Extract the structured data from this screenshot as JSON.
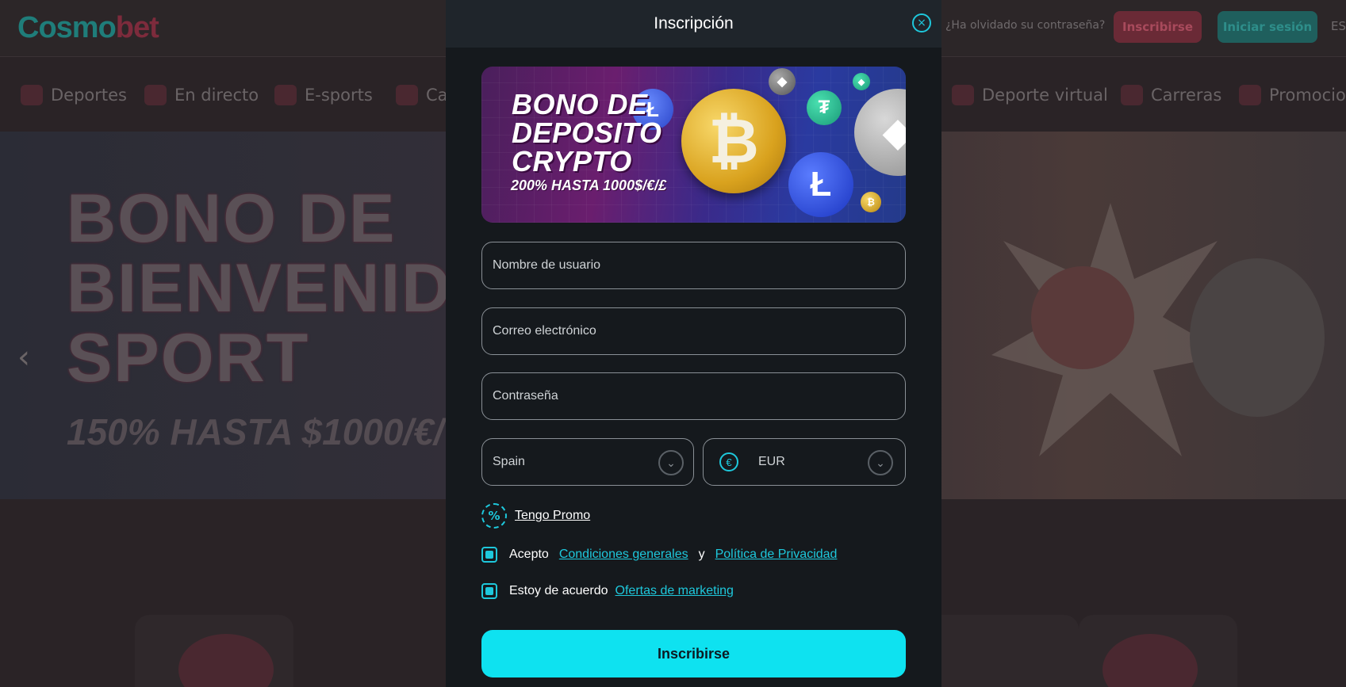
{
  "background": {
    "logo": {
      "part1": "Cosmo",
      "part2": "bet"
    },
    "header": {
      "forgot_password": "¿Ha olvidado su contraseña?",
      "register_button": "Inscribirse",
      "login_button": "Iniciar sesión",
      "language": "ES"
    },
    "nav": [
      {
        "label": "Deportes",
        "icon": "soccer-ball-icon"
      },
      {
        "label": "En directo",
        "icon": "live-broadcast-icon"
      },
      {
        "label": "E-sports",
        "icon": "gamepad-icon"
      },
      {
        "label": "Ca",
        "icon": "cards-icon"
      },
      {
        "label": "Deporte virtual",
        "icon": "checkered-flag-icon"
      },
      {
        "label": "Carreras",
        "icon": "horse-icon"
      },
      {
        "label": "Promocion",
        "icon": "megaphone-icon"
      }
    ],
    "hero": {
      "title_line1": "BONO DE",
      "title_line2": "BIENVENID",
      "title_line3": "SPORT",
      "subtitle": "150% HASTA $1000/€/",
      "prev_arrow": "‹"
    }
  },
  "modal": {
    "title": "Inscripción",
    "close_glyph": "×",
    "banner": {
      "title_line1": "BONO DE",
      "title_line2": "DEPOSITO",
      "title_line3": "CRYPTO",
      "subtitle": "200% HASTA 1000$/€/£"
    },
    "fields": {
      "username_placeholder": "Nombre de usuario",
      "email_placeholder": "Correo electrónico",
      "password_placeholder": "Contraseña"
    },
    "country": {
      "value": "Spain"
    },
    "currency": {
      "symbol": "€",
      "value": "EUR"
    },
    "promo": {
      "icon_glyph": "%",
      "label": "Tengo Promo"
    },
    "terms": {
      "prefix": "Acepto",
      "link1": "Condiciones generales",
      "conjunction": "y",
      "link2": "Política de Privacidad",
      "checked": true
    },
    "marketing": {
      "prefix": "Estoy de acuerdo",
      "link": "Ofertas de marketing",
      "checked": true
    },
    "submit_label": "Inscribirse"
  },
  "colors": {
    "accent": "#0ee2f0",
    "link": "#1ec8dc",
    "modal_bg": "#15191d",
    "modal_header": "#1f252b"
  }
}
